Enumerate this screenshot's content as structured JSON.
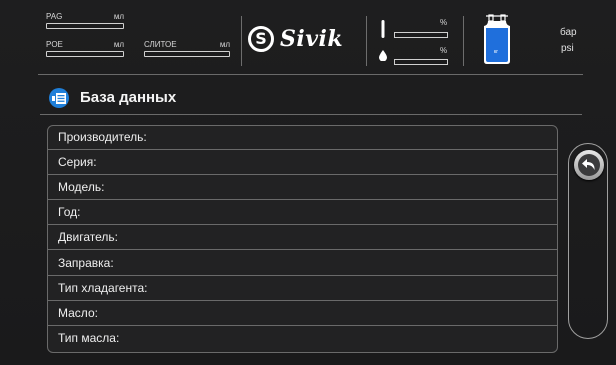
{
  "header": {
    "pag_label": "PAG",
    "pag_unit": "мл",
    "poe_label": "POE",
    "poe_unit": "мл",
    "dye_label": "СЛИТОЕ",
    "dye_unit": "мл",
    "logo_text": "Sivik",
    "percent_1": "%",
    "percent_2": "%",
    "tank_unit": "кг",
    "pressure_unit_1": "бар",
    "pressure_unit_2": "psi"
  },
  "page": {
    "title": "База данных",
    "icon": "database-icon"
  },
  "table": {
    "rows": [
      "Производитель:",
      "Серия:",
      "Модель:",
      "Год:",
      "Двигатель:",
      "Заправка:",
      "Тип хладагента:",
      "Масло:",
      "Тип масла:"
    ]
  },
  "side": {
    "back_icon": "back-arrow-icon"
  },
  "colors": {
    "background": "#1b1b1c",
    "accent_blue": "#1f7fd9",
    "border": "#6a6a6a"
  }
}
